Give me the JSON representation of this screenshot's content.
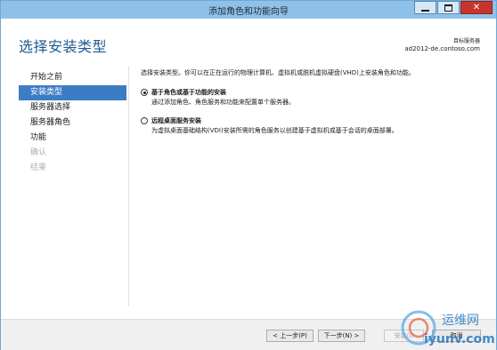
{
  "window": {
    "title": "添加角色和功能向导",
    "minimize_icon": "minimize-icon",
    "maximize_icon": "maximize-icon",
    "close_icon": "close-icon"
  },
  "header": {
    "page_title": "选择安装类型",
    "destination_label": "目标服务器",
    "destination_server": "ad2012-de.contoso.com"
  },
  "nav": {
    "items": [
      {
        "label": "开始之前",
        "state": "normal"
      },
      {
        "label": "安装类型",
        "state": "active"
      },
      {
        "label": "服务器选择",
        "state": "normal"
      },
      {
        "label": "服务器角色",
        "state": "normal"
      },
      {
        "label": "功能",
        "state": "normal"
      },
      {
        "label": "确认",
        "state": "disabled"
      },
      {
        "label": "结果",
        "state": "disabled"
      }
    ]
  },
  "content": {
    "intro": "选择安装类型。你可以在正在运行的物理计算机、虚拟机或脱机虚拟硬盘(VHD)上安装角色和功能。",
    "options": [
      {
        "label": "基于角色或基于功能的安装",
        "description": "通过添加角色、角色服务和功能来配置单个服务器。",
        "selected": true
      },
      {
        "label": "远程桌面服务安装",
        "description": "为虚拟桌面基础结构(VDI)安装所需的角色服务以创建基于虚拟机或基于会话的桌面部署。",
        "selected": false
      }
    ]
  },
  "footer": {
    "prev_label": "< 上一步(P)",
    "next_label": "下一步(N) >",
    "install_label": "安装(I)",
    "cancel_label": "取消"
  },
  "watermark": {
    "text_cn": "运维网",
    "text_url": "iyunv.com"
  },
  "colors": {
    "titlebar": "#8fc1e8",
    "accent": "#1d5b8f",
    "nav_active": "#3c7cc4",
    "close": "#c7342e"
  }
}
